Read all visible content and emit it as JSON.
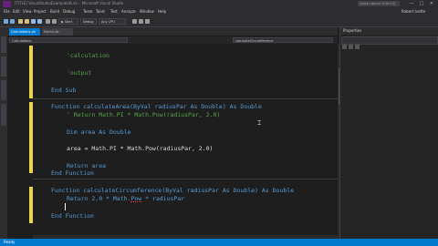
{
  "window": {
    "title": "[TITLE] VisualStudioExampleVB.sln - Microsoft Visual Studio",
    "quick_launch_placeholder": "Quick Launch (Ctrl+Q)",
    "user_name": "Robert Ivette",
    "minimize_glyph": "—",
    "maximize_glyph": "□",
    "close_glyph": "✕"
  },
  "menu": {
    "items": [
      "File",
      "Edit",
      "View",
      "Project",
      "Build",
      "Debug",
      "Team",
      "Tools",
      "Test",
      "Analyze",
      "Window",
      "Help"
    ]
  },
  "toolbar": {
    "config": "Debug",
    "platform": "Any CPU",
    "start_label": "▶ Start"
  },
  "tabs": [
    {
      "label": "Calculations.vb"
    },
    {
      "label": "Form1.vb [Design]"
    }
  ],
  "navbar": {
    "left": "Calculations",
    "right": "calculateCircumference"
  },
  "code": {
    "lines": [
      {
        "text": "'calculation",
        "kind": "comment"
      },
      {
        "text": "'output",
        "kind": "comment"
      },
      {
        "text": "End Sub",
        "kind": "keyword"
      },
      {
        "text": "Function calculateArea(ByVal radiusPar As Double) As Double",
        "kind": "signature"
      },
      {
        "text": "' Return Math.PI * Math.Pow(radiusPar, 2.0)",
        "kind": "comment"
      },
      {
        "text": "Dim area As Double",
        "kind": "keyword"
      },
      {
        "text": "area = Math.PI * Math.Pow(radiusPar, 2.0)",
        "kind": "normal"
      },
      {
        "text": "Return area",
        "kind": "keyword"
      },
      {
        "text": "End Function",
        "kind": "keyword"
      },
      {
        "text": "Function calculateCircumference(ByVal radiusPar As Double) As Double",
        "kind": "signature"
      },
      {
        "text": "Return 2.0 * Math.Pow * radiusPar",
        "kind": "normal"
      },
      {
        "text": "End Function",
        "kind": "keyword"
      }
    ]
  },
  "properties": {
    "title": "Properties"
  },
  "status": {
    "text": "Ready"
  },
  "colors": {
    "accent": "#007acc",
    "keyword": "#569cd6",
    "comment": "#57a64a",
    "change_marker": "#e8d44d"
  }
}
